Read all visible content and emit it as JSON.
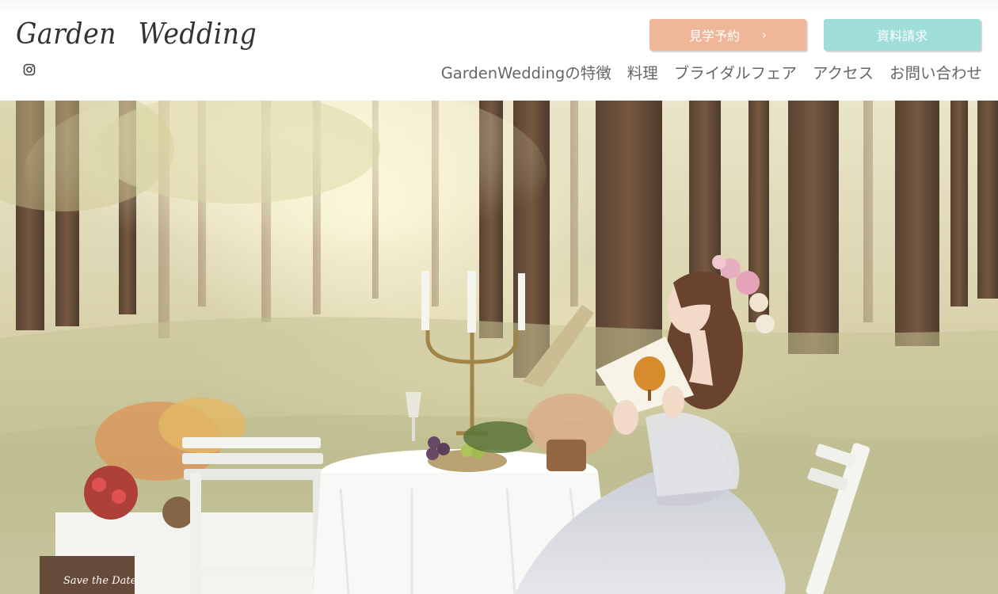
{
  "brand": {
    "logo_word1": "Garden",
    "logo_word2": "Wedding"
  },
  "social": {
    "icon": "instagram-icon"
  },
  "cta": {
    "visit_label": "見学予約",
    "visit_chevron": "›",
    "docs_label": "資料請求",
    "visit_color": "#f0b699",
    "docs_color": "#9fddd9"
  },
  "nav": {
    "items": [
      {
        "label": "GardenWeddingの特徴"
      },
      {
        "label": "料理"
      },
      {
        "label": "ブライダルフェア"
      },
      {
        "label": "アクセス"
      },
      {
        "label": "お問い合わせ"
      }
    ]
  },
  "hero": {
    "image": "bride-reading-book-at-forest-table-photo",
    "sign_text": "Save the Date"
  }
}
